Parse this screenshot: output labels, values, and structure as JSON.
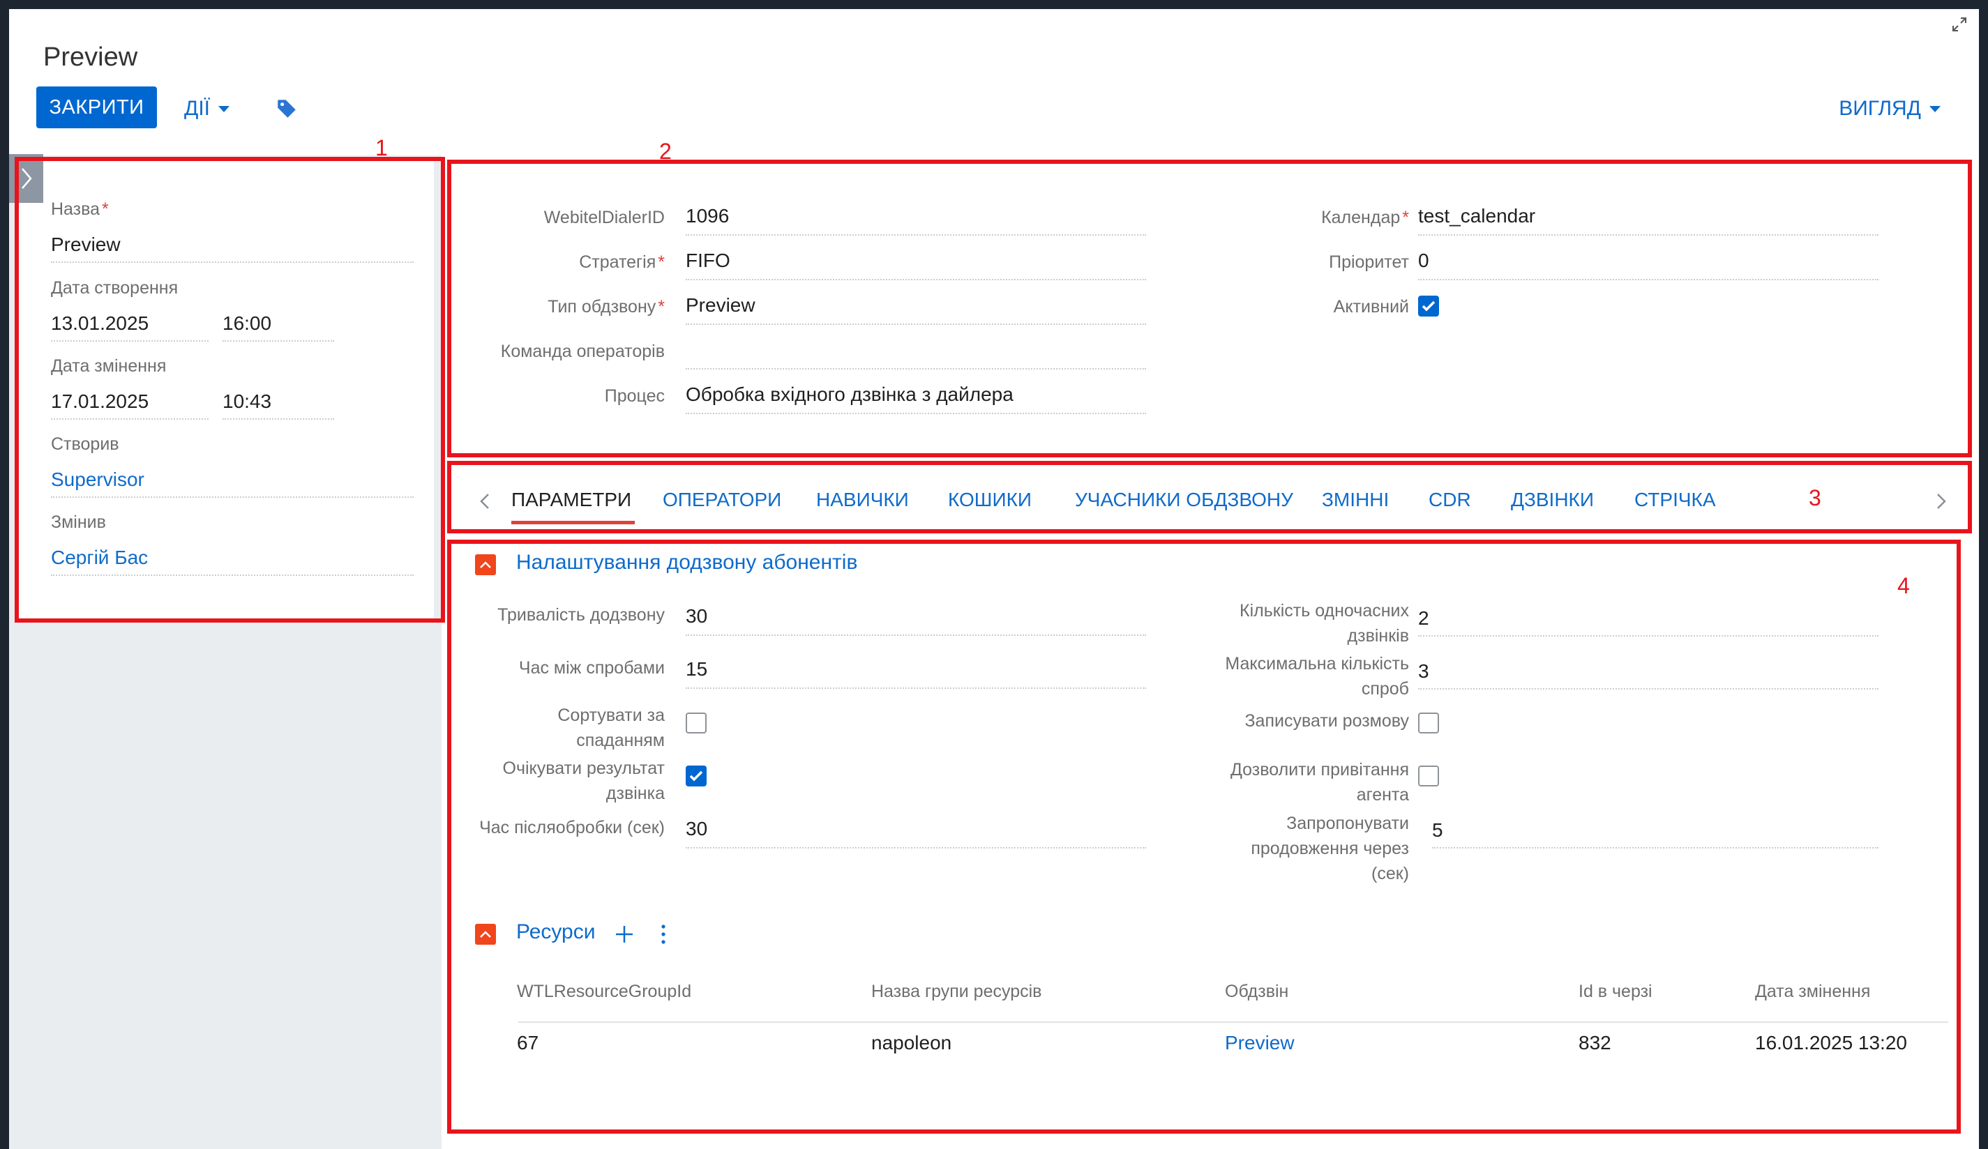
{
  "page": {
    "title": "Preview"
  },
  "toolbar": {
    "close_label": "ЗАКРИТИ",
    "actions_label": "ДІЇ",
    "view_label": "ВИГЛЯД"
  },
  "sidebar": {
    "name_label": "Назва",
    "name_value": "Preview",
    "created_label": "Дата створення",
    "created_date": "13.01.2025",
    "created_time": "16:00",
    "modified_label": "Дата змінення",
    "modified_date": "17.01.2025",
    "modified_time": "10:43",
    "created_by_label": "Створив",
    "created_by_value": "Supervisor",
    "modified_by_label": "Змінив",
    "modified_by_value": "Сергій Бас"
  },
  "header_fields": {
    "dialer_id_label": "WebitelDialerID",
    "dialer_id_value": "1096",
    "strategy_label": "Стратегія",
    "strategy_value": "FIFO",
    "type_label": "Тип обдзвону",
    "type_value": "Preview",
    "team_label": "Команда операторів",
    "team_value": "",
    "process_label": "Процес",
    "process_value": "Обробка вхідного дзвінка з дайлера",
    "calendar_label": "Календар",
    "calendar_value": "test_calendar",
    "priority_label": "Пріоритет",
    "priority_value": "0",
    "active_label": "Активний",
    "active_checked": true
  },
  "tabs": [
    {
      "label": "ПАРАМЕТРИ",
      "active": true
    },
    {
      "label": "ОПЕРАТОРИ"
    },
    {
      "label": "НАВИЧКИ"
    },
    {
      "label": "КОШИКИ"
    },
    {
      "label": "УЧАСНИКИ ОБДЗВОНУ"
    },
    {
      "label": "ЗМІННІ"
    },
    {
      "label": "CDR"
    },
    {
      "label": "ДЗВІНКИ"
    },
    {
      "label": "СТРІЧКА"
    }
  ],
  "settings": {
    "title": "Налаштування додзвону абонентів",
    "ring_duration_label": "Тривалість додзвону",
    "ring_duration_value": "30",
    "retry_interval_label": "Час між спробами",
    "retry_interval_value": "15",
    "sort_desc_label_1": "Сортувати за",
    "sort_desc_label_2": "спаданням",
    "sort_desc_checked": false,
    "wait_result_label_1": "Очікувати результат",
    "wait_result_label_2": "дзвінка",
    "wait_result_checked": true,
    "wrapup_label": "Час післяобробки (сек)",
    "wrapup_value": "30",
    "concurrent_label_1": "Кількість одночасних",
    "concurrent_label_2": "дзвінків",
    "concurrent_value": "2",
    "max_attempts_label_1": "Максимальна кількість",
    "max_attempts_label_2": "спроб",
    "max_attempts_value": "3",
    "record_label": "Записувати розмову",
    "record_checked": false,
    "greeting_label_1": "Дозволити привітання",
    "greeting_label_2": "агента",
    "greeting_checked": false,
    "offer_label_1": "Запропонувати",
    "offer_label_2": "продовження через",
    "offer_label_3": "(сек)",
    "offer_value": "5"
  },
  "resources": {
    "title": "Ресурси",
    "columns": [
      "WTLResourceGroupId",
      "Назва групи ресурсів",
      "Обдзвін",
      "Id в черзі",
      "Дата змінення"
    ],
    "rows": [
      [
        "67",
        "napoleon",
        "Preview",
        "832",
        "16.01.2025 13:20"
      ]
    ]
  },
  "annotations": [
    "1",
    "2",
    "3",
    "4"
  ],
  "colors": {
    "accent": "#0067d0",
    "link": "#0e6bcb",
    "annotation": "#e8141c",
    "section_toggle": "#f1451b"
  }
}
